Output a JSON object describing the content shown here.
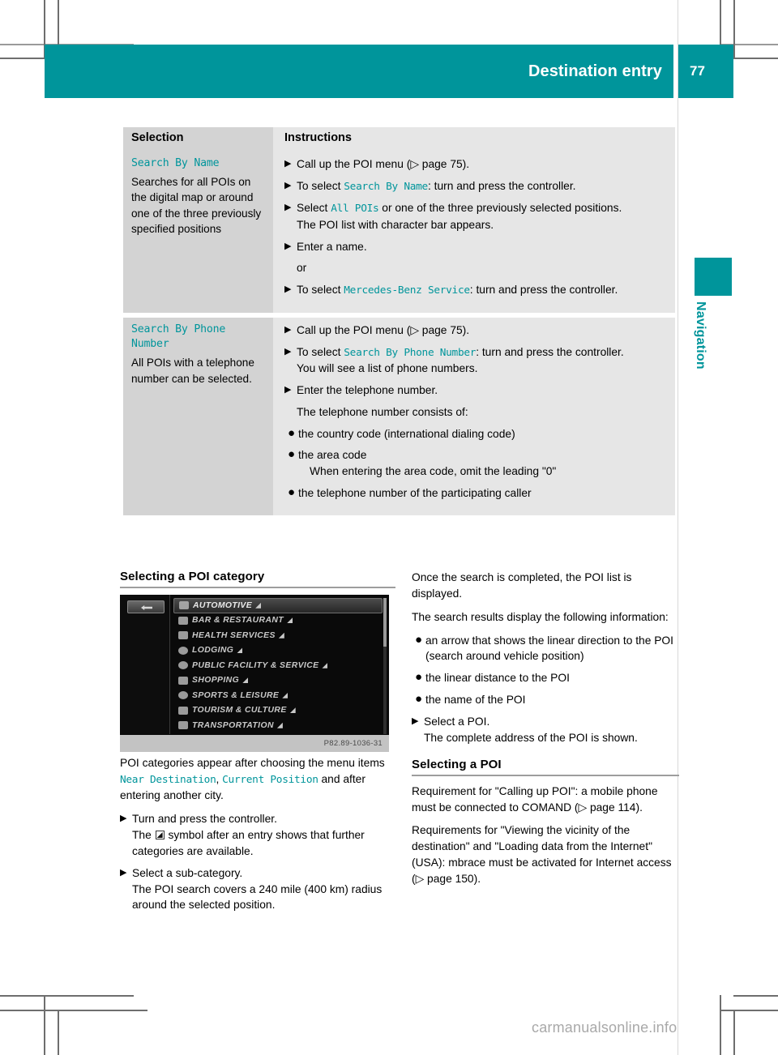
{
  "header": {
    "title": "Destination entry",
    "page_number": "77",
    "accent_color": "#00959b"
  },
  "chapter": {
    "label": "Navigation"
  },
  "table": {
    "columns": [
      "Selection",
      "Instructions"
    ],
    "rows": [
      {
        "term": "Search By Name",
        "description": "Searches for all POIs on the digital map or around one of the three previously specified positions",
        "steps": [
          {
            "kind": "step",
            "pre": "Call up the POI menu (",
            "ref": "▷ page 75",
            "post": ")."
          },
          {
            "kind": "step",
            "pre": "To select ",
            "mono": "Search By Name",
            "post": ": turn and press the controller."
          },
          {
            "kind": "step",
            "pre": "Select ",
            "mono": "All POIs",
            "post": " or one of the three previously selected positions.",
            "sub": "The POI list with character bar appears."
          },
          {
            "kind": "step",
            "pre": "Enter a name."
          },
          {
            "kind": "plain",
            "text": "or"
          },
          {
            "kind": "step",
            "pre": "To select ",
            "mono": "Mercedes-Benz Service",
            "post": ": turn and press the controller."
          }
        ]
      },
      {
        "term": "Search By Phone Number",
        "description": "All POIs with a telephone number can be selected.",
        "steps": [
          {
            "kind": "step",
            "pre": "Call up the POI menu (",
            "ref": "▷ page 75",
            "post": ")."
          },
          {
            "kind": "step",
            "pre": "To select ",
            "mono": "Search By Phone Number",
            "post": ": turn and press the controller.",
            "sub": "You will see a list of phone numbers."
          },
          {
            "kind": "step",
            "pre": "Enter the telephone number."
          },
          {
            "kind": "plain",
            "text": "The telephone number consists of:"
          },
          {
            "kind": "bullet",
            "text": "the country code (international dialing code)"
          },
          {
            "kind": "bullet",
            "text": "the area code",
            "sub": "When entering the area code, omit the leading \"0\""
          },
          {
            "kind": "bullet",
            "text": "the telephone number of the participating caller"
          }
        ]
      }
    ]
  },
  "left_column": {
    "section_title": "Selecting a POI category",
    "figure": {
      "back_button": "back-arrow",
      "items": [
        {
          "label": "AUTOMOTIVE",
          "selected": true,
          "icon": "car-icon"
        },
        {
          "label": "BAR & RESTAURANT",
          "selected": false,
          "icon": "cup-icon"
        },
        {
          "label": "HEALTH SERVICES",
          "selected": false,
          "icon": "cross-icon"
        },
        {
          "label": "LODGING",
          "selected": false,
          "icon": "bed-icon"
        },
        {
          "label": "PUBLIC FACILITY & SERVICE",
          "selected": false,
          "icon": "building-icon"
        },
        {
          "label": "SHOPPING",
          "selected": false,
          "icon": "cart-icon"
        },
        {
          "label": "SPORTS & LEISURE",
          "selected": false,
          "icon": "ball-icon"
        },
        {
          "label": "TOURISM & CULTURE",
          "selected": false,
          "icon": "camera-icon"
        },
        {
          "label": "TRANSPORTATION",
          "selected": false,
          "icon": "plane-icon"
        }
      ],
      "image_code": "P82.89-1036-31"
    },
    "intro_pre": "POI categories appear after choosing the menu items ",
    "intro_mono1": "Near Destination",
    "intro_sep": ", ",
    "intro_mono2": "Current Position",
    "intro_post": " and after entering another city.",
    "steps": [
      {
        "text": "Turn and press the controller.",
        "sub_pre": "The ",
        "sub_post": " symbol after an entry shows that further categories are available."
      },
      {
        "text": "Select a sub-category.",
        "sub": "The POI search covers a 240 mile (400 km) radius around the selected position."
      }
    ]
  },
  "right_column": {
    "para1": "Once the search is completed, the POI list is displayed.",
    "para2": "The search results display the following information:",
    "bullets": [
      "an arrow that shows the linear direction to the POI (search around vehicle position)",
      "the linear distance to the POI",
      "the name of the POI"
    ],
    "step_text": "Select a POI.",
    "step_sub": "The complete address of the POI is shown.",
    "section_title": "Selecting a POI",
    "para3_pre": "Requirement for \"Calling up POI\": a mobile phone must be connected to COMAND (",
    "para3_ref": "▷ page 114",
    "para3_post": ").",
    "para4_pre": "Requirements for \"Viewing the vicinity of the destination\" and \"Loading data from the Internet\" (USA): mbrace must be activated for Internet access (",
    "para4_ref": "▷ page 150",
    "para4_post": ")."
  },
  "watermark": "carmanualsonline.info"
}
